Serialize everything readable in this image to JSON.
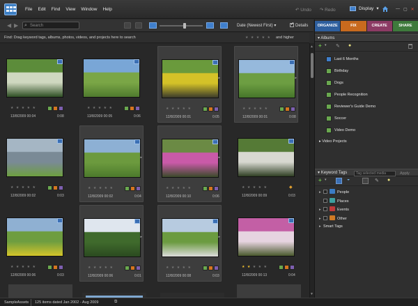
{
  "menu": {
    "items": [
      "File",
      "Edit",
      "Find",
      "View",
      "Window",
      "Help"
    ],
    "undo": "Undo",
    "redo": "Redo",
    "display": "Display"
  },
  "toolbar": {
    "search_placeholder": "Search",
    "sort": "Date (Newest First)",
    "details": "Details"
  },
  "findbar": {
    "hint": "Find: Drag keyword tags, albums, photos, videos, and projects here to search",
    "stars": "★ ★ ★ ★ ★",
    "and_higher": "and higher"
  },
  "grid": {
    "items": [
      {
        "date": "13/8/2009 00:04",
        "duration": "0:08",
        "stars": "★ ★ ★ ★ ★",
        "colors": [
          "#5c8c3a",
          "#cfd8c0",
          "#2f4f24"
        ],
        "selected": false
      },
      {
        "date": "13/8/2009 00:05",
        "duration": "0:06",
        "stars": "★ ★ ★ ★ ★",
        "colors": [
          "#79a6d6",
          "#7aa646",
          "#4f7a2e"
        ],
        "selected": false
      },
      {
        "date": "12/8/2009 00:01",
        "duration": "0:05",
        "stars": "★ ★ ★ ★ ★",
        "colors": [
          "#6a9a3c",
          "#d4c228",
          "#3b3b2a"
        ],
        "selected": true
      },
      {
        "date": "12/8/2009 00:01",
        "duration": "0:08",
        "stars": "★ ★ ★ ★ ★",
        "colors": [
          "#96b9dc",
          "#6d9e42",
          "#45752a"
        ],
        "selected": true
      },
      {
        "date": "12/8/2009 00:02",
        "duration": "0:03",
        "stars": "★ ★ ★ ★ ★",
        "colors": [
          "#a5b6c4",
          "#7a8a96",
          "#6e9f40"
        ],
        "selected": false
      },
      {
        "date": "12/8/2009 00:02",
        "duration": "0:04",
        "stars": "★ ★ ★ ★ ★",
        "colors": [
          "#8db0d4",
          "#6c9a3e",
          "#4c7a2c"
        ],
        "selected": true
      },
      {
        "date": "12/8/2009 00:10",
        "duration": "0:06",
        "stars": "★ ★ ★ ★ ★",
        "colors": [
          "#6b8a44",
          "#c95aa8",
          "#3a4a2a"
        ],
        "selected": true
      },
      {
        "date": "12/8/2009 00:09",
        "duration": "0:03",
        "stars": "★ ★ ★ ★ ★",
        "colors": [
          "#557a36",
          "#d8d8d0",
          "#2f3f24"
        ],
        "selected": false
      },
      {
        "date": "12/8/2009 00:06",
        "duration": "0:03",
        "stars": "★ ★ ★ ★ ★",
        "colors": [
          "#8fb0d2",
          "#6e9d40",
          "#d4c52a"
        ],
        "selected": false
      },
      {
        "date": "12/8/2009 00:06",
        "duration": "0:01",
        "stars": "★ ★ ★ ★ ★",
        "colors": [
          "#dfe6ee",
          "#3f6a2c",
          "#2b4a20"
        ],
        "selected": true
      },
      {
        "date": "12/8/2009 00:08",
        "duration": "0:03",
        "stars": "★ ★ ★ ★ ★",
        "colors": [
          "#b7cbe0",
          "#6b9b40",
          "#dcdcdc"
        ],
        "selected": true
      },
      {
        "date": "12/8/2009 00:13",
        "duration": "0:04",
        "stars": "★ ★ ★ ★ ★",
        "gold_stars": 2,
        "colors": [
          "#c35fa5",
          "#e6d4e0",
          "#4a5a2e"
        ],
        "selected": false
      }
    ]
  },
  "status": {
    "catalog": "SampleAssets",
    "count": "125 items dated Jan 2002 - Aug 2009"
  },
  "tabs": {
    "organize": "ORGANIZE",
    "fix": "FIX",
    "create": "CREATE",
    "share": "SHARE"
  },
  "albums": {
    "title": "Albums",
    "items": [
      "Last 6 Months",
      "Birthday",
      "Dogs",
      "People Recognition",
      "Reviewer's Guide Demo",
      "Soccer",
      "Video Demo"
    ],
    "video_projects": "Video Projects"
  },
  "keywords": {
    "title": "Keyword Tags",
    "placeholder": "Tag selected media",
    "apply": "Apply",
    "items": [
      {
        "label": "People",
        "color": "#3b7dc6"
      },
      {
        "label": "Places",
        "color": "#3fa0a0"
      },
      {
        "label": "Events",
        "color": "#c03a3a"
      },
      {
        "label": "Other",
        "color": "#d07a24"
      }
    ],
    "smart_tags": "Smart Tags"
  }
}
